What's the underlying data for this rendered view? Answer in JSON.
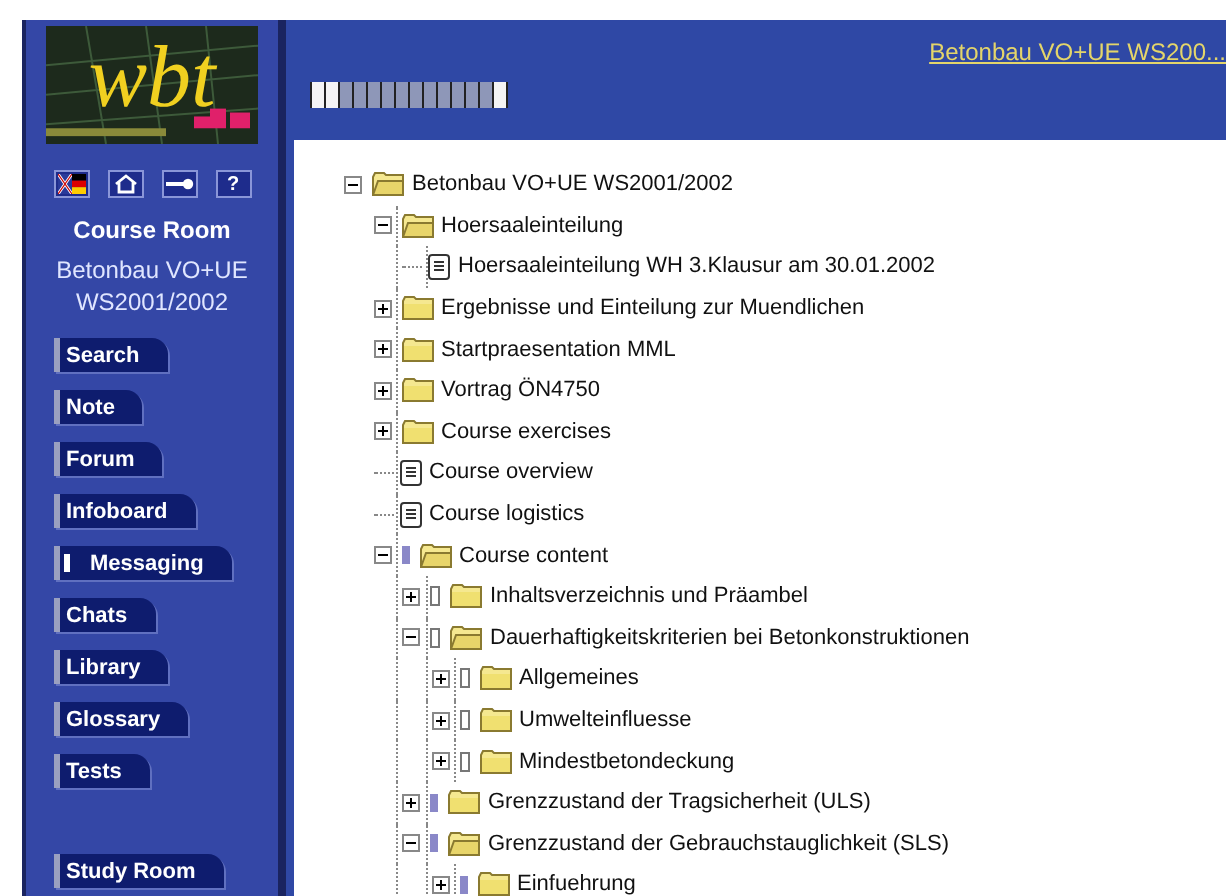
{
  "logo": {
    "text": "wbt"
  },
  "toolbar": {
    "help_label": "?"
  },
  "sidebar": {
    "title": "Course Room",
    "course_lines": [
      "Betonbau VO+UE",
      "WS2001/2002"
    ],
    "buttons": [
      {
        "label": "Search",
        "indicator": false
      },
      {
        "label": "Note",
        "indicator": false
      },
      {
        "label": "Forum",
        "indicator": false
      },
      {
        "label": "Infoboard",
        "indicator": false
      },
      {
        "label": "Messaging",
        "indicator": true
      },
      {
        "label": "Chats",
        "indicator": false
      },
      {
        "label": "Library",
        "indicator": false
      },
      {
        "label": "Glossary",
        "indicator": false
      },
      {
        "label": "Tests",
        "indicator": false
      }
    ],
    "bottom_button": {
      "label": "Study Room"
    }
  },
  "header": {
    "course_link": "Betonbau VO+UE WS200..."
  },
  "tree": [
    {
      "kind": "folder",
      "label": "Betonbau VO+UE WS2001/2002",
      "expanded": true,
      "children": [
        {
          "kind": "folder",
          "label": "Hoersaaleinteilung",
          "expanded": true,
          "children": [
            {
              "kind": "document",
              "label": "Hoersaaleinteilung WH 3.Klausur am 30.01.2002"
            }
          ]
        },
        {
          "kind": "folder",
          "label": "Ergebnisse und Einteilung zur Muendlichen",
          "expanded": false
        },
        {
          "kind": "folder",
          "label": "Startpraesentation MML",
          "expanded": false
        },
        {
          "kind": "folder",
          "label": "Vortrag ÖN4750",
          "expanded": false
        },
        {
          "kind": "folder",
          "label": "Course exercises",
          "expanded": false
        },
        {
          "kind": "document",
          "label": "Course overview"
        },
        {
          "kind": "document",
          "label": "Course logistics"
        },
        {
          "kind": "folder",
          "label": "Course content",
          "expanded": true,
          "done": true,
          "children": [
            {
              "kind": "folder",
              "label": "Inhaltsverzeichnis und Präambel",
              "expanded": false,
              "done": false
            },
            {
              "kind": "folder",
              "label": "Dauerhaftigkeitskriterien bei Betonkonstruktionen",
              "expanded": true,
              "done": false,
              "children": [
                {
                  "kind": "folder",
                  "label": "Allgemeines",
                  "expanded": false,
                  "done": false
                },
                {
                  "kind": "folder",
                  "label": "Umwelteinfluesse",
                  "expanded": false,
                  "done": false
                },
                {
                  "kind": "folder",
                  "label": "Mindestbetondeckung",
                  "expanded": false,
                  "done": false
                }
              ]
            },
            {
              "kind": "folder",
              "label": "Grenzzustand der Tragsicherheit (ULS)",
              "expanded": false,
              "done": true
            },
            {
              "kind": "folder",
              "label": "Grenzzustand der Gebrauchstauglichkeit (SLS)",
              "expanded": true,
              "done": true,
              "children": [
                {
                  "kind": "folder",
                  "label": "Einfuehrung",
                  "expanded": false,
                  "done": true
                }
              ]
            }
          ]
        }
      ]
    }
  ]
}
